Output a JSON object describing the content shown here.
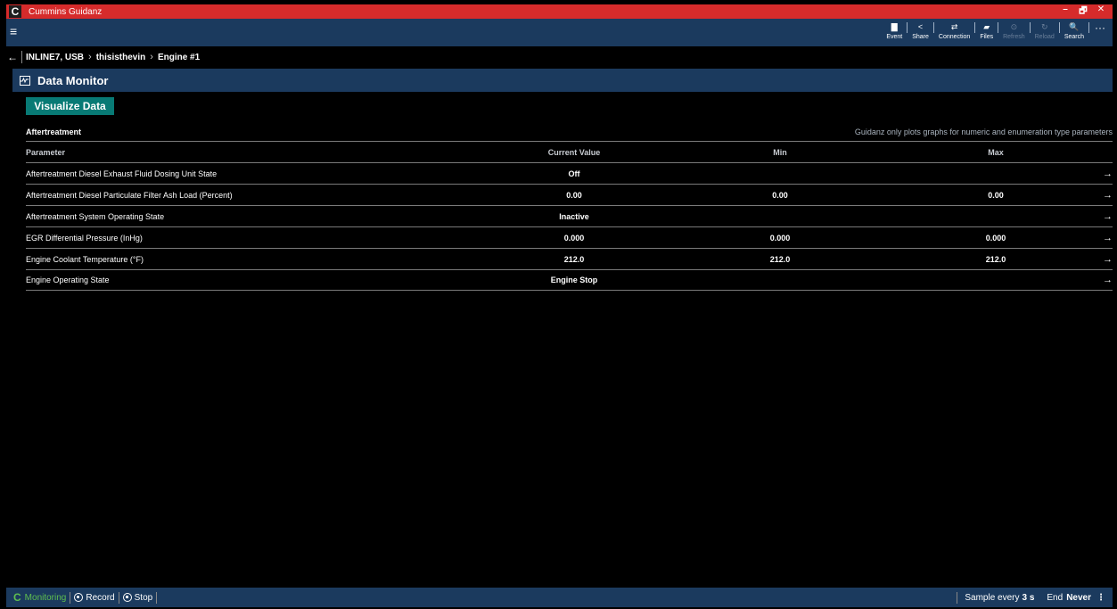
{
  "window": {
    "title": "Cummins Guidanz",
    "logo_letter": "C",
    "controls": {
      "minimize": "–",
      "restore": "🗗",
      "close": "✕"
    }
  },
  "commandbar": {
    "items": [
      {
        "label": "Event",
        "icon": "document-icon",
        "glyph": "▇",
        "enabled": true
      },
      {
        "label": "Share",
        "icon": "share-icon",
        "glyph": "<",
        "enabled": true
      },
      {
        "label": "Connection",
        "icon": "connection-icon",
        "glyph": "⇄",
        "enabled": true
      },
      {
        "label": "Files",
        "icon": "files-icon",
        "glyph": "▰",
        "enabled": true
      },
      {
        "label": "Refresh",
        "icon": "refresh-icon",
        "glyph": "⊙",
        "enabled": false
      },
      {
        "label": "Reload",
        "icon": "reload-icon",
        "glyph": "↻",
        "enabled": false
      },
      {
        "label": "Search",
        "icon": "search-icon",
        "glyph": "🔍",
        "enabled": true
      }
    ],
    "more": "···"
  },
  "breadcrumb": {
    "items": [
      "INLINE7, USB",
      "thisisthevin",
      "Engine #1"
    ]
  },
  "section": {
    "title": "Data Monitor"
  },
  "visualize_button": "Visualize Data",
  "group": {
    "title": "Aftertreatment",
    "note": "Guidanz only plots graphs for numeric and enumeration type parameters"
  },
  "table": {
    "headers": {
      "parameter": "Parameter",
      "current": "Current Value",
      "min": "Min",
      "max": "Max"
    },
    "rows": [
      {
        "parameter": "Aftertreatment Diesel Exhaust Fluid Dosing Unit State",
        "current": "Off",
        "min": "",
        "max": ""
      },
      {
        "parameter": "Aftertreatment Diesel Particulate Filter Ash Load (Percent)",
        "current": "0.00",
        "min": "0.00",
        "max": "0.00"
      },
      {
        "parameter": "Aftertreatment System Operating State",
        "current": "Inactive",
        "min": "",
        "max": ""
      },
      {
        "parameter": "EGR Differential Pressure (InHg)",
        "current": "0.000",
        "min": "0.000",
        "max": "0.000"
      },
      {
        "parameter": "Engine Coolant Temperature (°F)",
        "current": "212.0",
        "min": "212.0",
        "max": "212.0"
      },
      {
        "parameter": "Engine Operating State",
        "current": "Engine Stop",
        "min": "",
        "max": ""
      }
    ],
    "arrow": "→"
  },
  "statusbar": {
    "monitoring": "Monitoring",
    "record": "Record",
    "stop": "Stop",
    "sample_label": "Sample every",
    "sample_value": "3 s",
    "end_label": "End",
    "end_value": "Never"
  },
  "colors": {
    "titlebar": "#d62b2b",
    "navy": "#1b3a5e",
    "teal_button": "#087a75",
    "monitoring_green": "#5fbf4f"
  }
}
